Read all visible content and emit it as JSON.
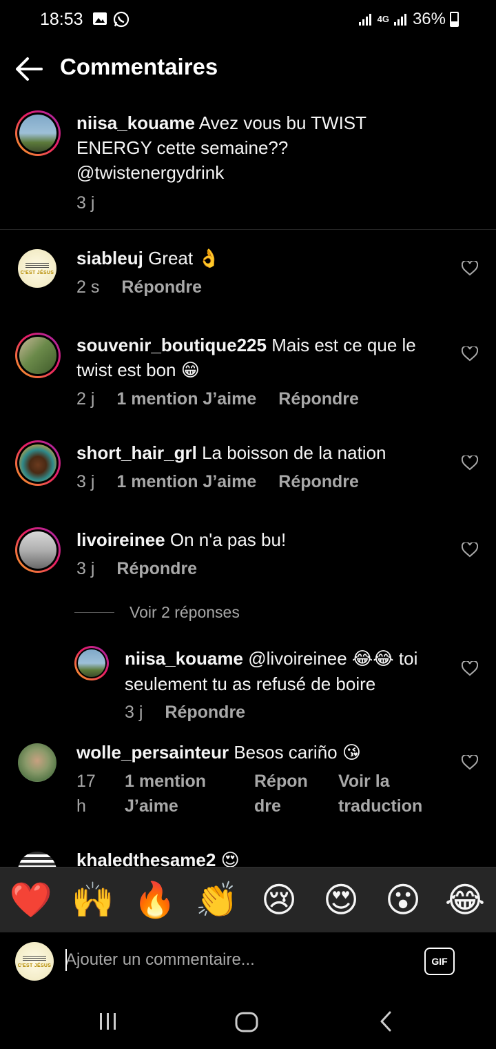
{
  "status": {
    "time": "18:53",
    "network": "4G",
    "battery": "36%"
  },
  "header": {
    "title": "Commentaires"
  },
  "caption": {
    "username": "niisa_kouame",
    "text_line1": "Avez vous bu TWIST",
    "text_line2": "ENERGY cette semaine??",
    "text_line3": "@twistenergydrink",
    "time": "3 j"
  },
  "comments": [
    {
      "username": "siableuj",
      "text": "Great",
      "emoji": "👌",
      "time": "2 s",
      "reply": "Répondre"
    },
    {
      "username": "souvenir_boutique225",
      "text_line1": "Mais est ce que le",
      "text_line2": "twist est bon",
      "emoji": "😁",
      "time": "2 j",
      "likes": "1 mention J’aime",
      "reply": "Répondre"
    },
    {
      "username": "short_hair_grl",
      "text": "La boisson de la nation",
      "time": "3 j",
      "likes": "1 mention J’aime",
      "reply": "Répondre"
    },
    {
      "username": "livoireinee",
      "text": "On n'a pas bu!",
      "time": "3 j",
      "reply": "Répondre"
    },
    {
      "username": "wolle_persainteur",
      "text": "Besos cariño",
      "emoji": "😘",
      "time_line1": "17",
      "time_line2": "h",
      "likes_line1": "1 mention",
      "likes_line2": "J’aime",
      "reply_line1": "Répon",
      "reply_line2": "dre",
      "translate_line1": "Voir la",
      "translate_line2": "traduction"
    },
    {
      "username": "khaledthesame2",
      "emoji": "😍"
    }
  ],
  "view_replies": "Voir 2 réponses",
  "reply": {
    "username": "niisa_kouame",
    "mention": "@livoireinee",
    "emoji": "😂😂",
    "text_line1_end": "toi",
    "text_line2": "seulement tu as refusé de boire",
    "time": "3 j",
    "reply": "Répondre"
  },
  "reactions": [
    "❤️",
    "🙌",
    "🔥",
    "👏",
    "😢",
    "😍",
    "😮",
    "😂"
  ],
  "input": {
    "placeholder": "Ajouter un commentaire...",
    "gif_label": "GIF"
  },
  "avatars": {
    "logo_text": "C'EST JÉSUS"
  }
}
